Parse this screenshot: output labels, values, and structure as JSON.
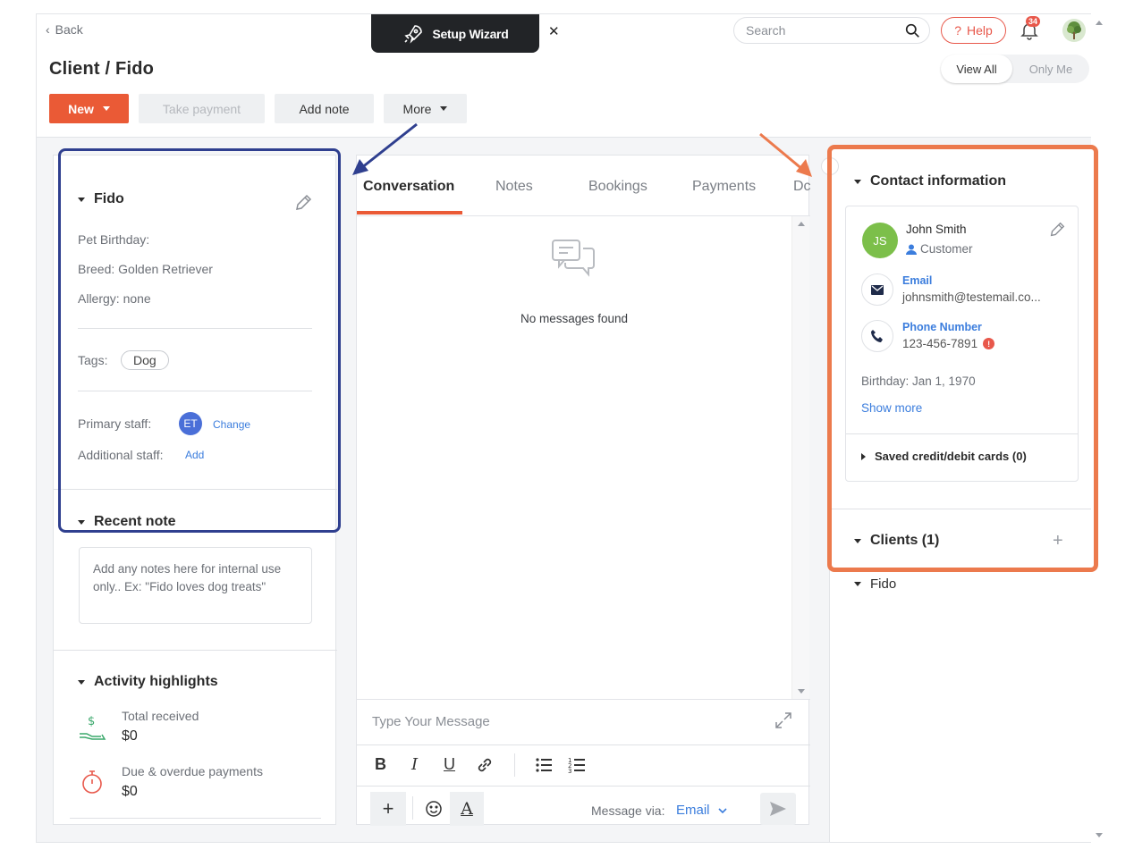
{
  "header": {
    "back_label": "Back",
    "wizard_label": "Setup Wizard",
    "search_placeholder": "Search",
    "help_label": "Help",
    "notification_count": "34",
    "page_title": "Client / Fido",
    "view_all": "View All",
    "only_me": "Only Me"
  },
  "toolbar": {
    "new_label": "New",
    "take_payment_label": "Take payment",
    "add_note_label": "Add note",
    "more_label": "More"
  },
  "pet": {
    "name": "Fido",
    "birthday": "Pet Birthday:",
    "breed": "Breed: Golden Retriever",
    "allergy": "Allergy: none",
    "tags_label": "Tags:",
    "tag": "Dog",
    "primary_staff_label": "Primary staff:",
    "primary_staff_initials": "ET",
    "change_label": "Change",
    "additional_staff_label": "Additional staff:",
    "add_label": "Add"
  },
  "recent_note": {
    "title": "Recent note",
    "placeholder": "Add any notes here for internal use only.. Ex: \"Fido loves dog treats\""
  },
  "activity": {
    "title": "Activity highlights",
    "total_received_label": "Total received",
    "total_received_value": "$0",
    "due_label": "Due & overdue payments",
    "due_value": "$0"
  },
  "conversation": {
    "tabs": [
      "Conversation",
      "Notes",
      "Bookings",
      "Payments",
      "Dc"
    ],
    "empty_text": "No messages found",
    "message_placeholder": "Type Your Message",
    "message_via_label": "Message via:",
    "message_via_value": "Email"
  },
  "contact": {
    "title": "Contact information",
    "initials": "JS",
    "name": "John Smith",
    "role": "Customer",
    "email_label": "Email",
    "email_value": "johnsmith@testemail.co...",
    "phone_label": "Phone Number",
    "phone_value": "123-456-7891",
    "birthday": "Birthday: Jan 1, 1970",
    "show_more": "Show more",
    "saved_cards": "Saved credit/debit cards (0)",
    "clients_title": "Clients (1)",
    "clients_item": "Fido"
  },
  "colors": {
    "accent": "#ea5a36",
    "link": "#3b7ddd",
    "highlight_blue": "#2f3f8f",
    "highlight_orange": "#ec7a4d"
  }
}
